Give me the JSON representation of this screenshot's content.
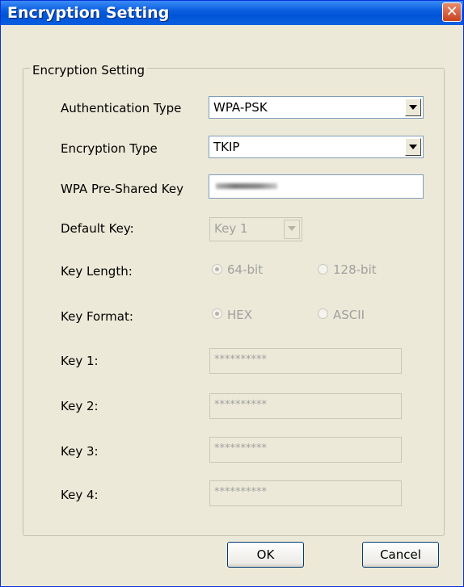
{
  "window": {
    "title": "Encryption Setting",
    "close_glyph": "✕"
  },
  "group": {
    "legend": "Encryption Setting"
  },
  "fields": {
    "auth_type": {
      "label": "Authentication Type",
      "value": "WPA-PSK"
    },
    "enc_type": {
      "label": "Encryption Type",
      "value": "TKIP"
    },
    "psk": {
      "label": "WPA Pre-Shared Key"
    },
    "default_key": {
      "label": "Default Key:",
      "value": "Key 1"
    },
    "key_length": {
      "label": "Key Length:",
      "options": [
        "64-bit",
        "128-bit"
      ],
      "selected": "64-bit"
    },
    "key_format": {
      "label": "Key Format:",
      "options": [
        "HEX",
        "ASCII"
      ],
      "selected": "HEX"
    },
    "keys": [
      {
        "label": "Key 1:",
        "value": "**********"
      },
      {
        "label": "Key 2:",
        "value": "**********"
      },
      {
        "label": "Key 3:",
        "value": "**********"
      },
      {
        "label": "Key 4:",
        "value": "**********"
      }
    ]
  },
  "buttons": {
    "ok": "OK",
    "cancel": "Cancel"
  },
  "colors": {
    "titlebar": "#0a5fe0",
    "face": "#ece9d8",
    "close": "#c8421e",
    "disabled_text": "#a0a0a0"
  }
}
